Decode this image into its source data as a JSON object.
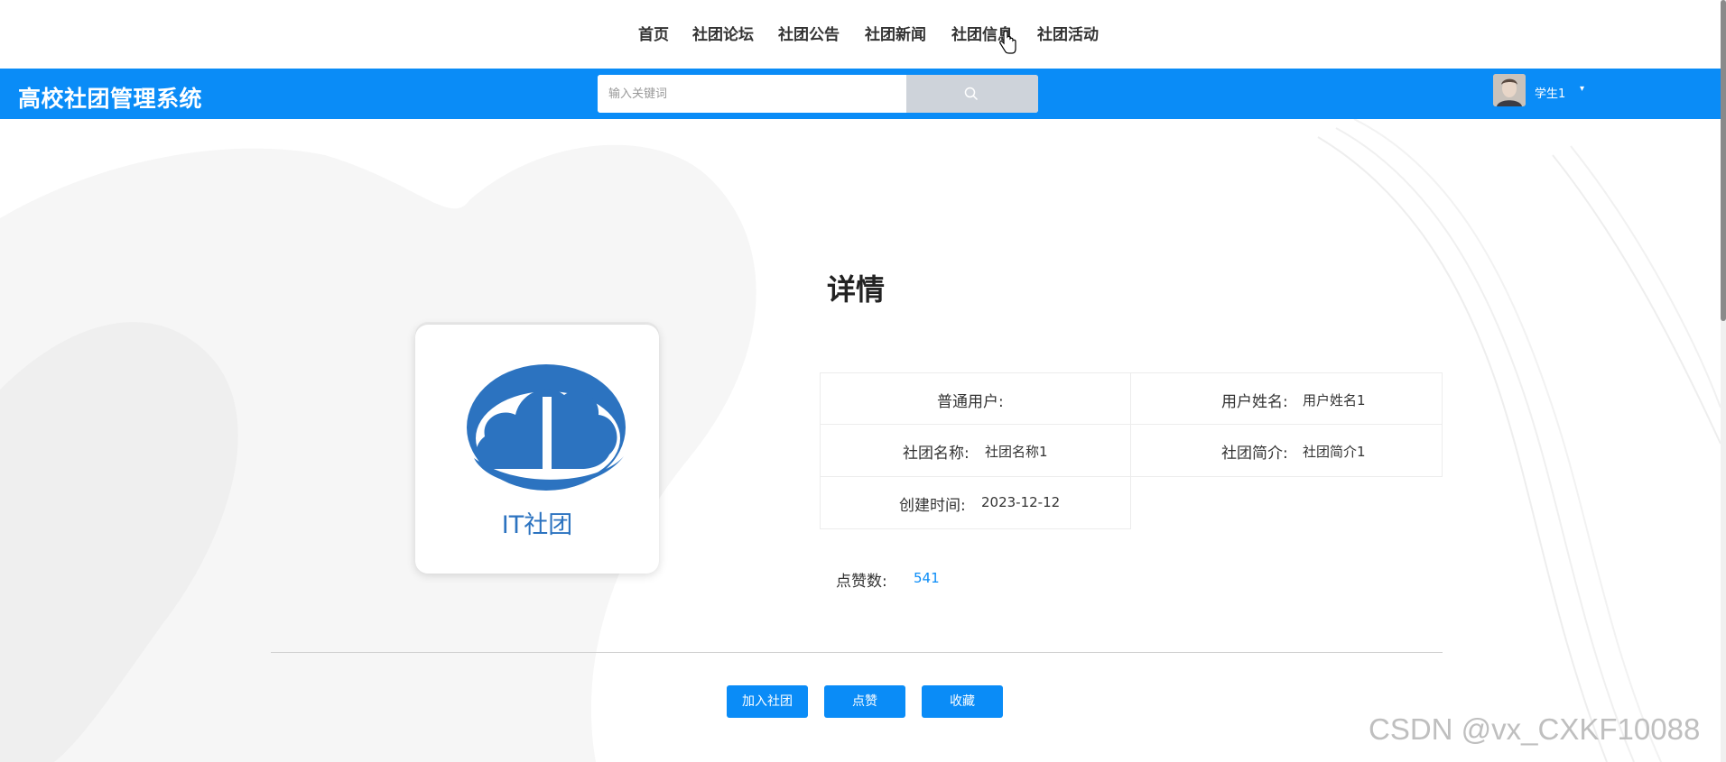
{
  "nav": {
    "items": [
      "首页",
      "社团论坛",
      "社团公告",
      "社团新闻",
      "社团信息",
      "社团活动"
    ]
  },
  "header": {
    "site_title": "高校社团管理系统",
    "search_placeholder": "输入关键词",
    "search_icon": "search-icon",
    "user_name": "学生1",
    "user_caret": "▾"
  },
  "detail": {
    "title": "详情",
    "logo_text": "IT社团",
    "fields": [
      {
        "label": "普通用户:",
        "value": ""
      },
      {
        "label": "用户姓名:",
        "value": "用户姓名1"
      },
      {
        "label": "社团名称:",
        "value": "社团名称1"
      },
      {
        "label": "社团简介:",
        "value": "社团简介1"
      },
      {
        "label": "创建时间:",
        "value": "2023-12-12"
      }
    ],
    "likes_label": "点赞数:",
    "likes_value": "541"
  },
  "actions": {
    "join": "加入社团",
    "like": "点赞",
    "favorite": "收藏"
  },
  "colors": {
    "accent": "#0a8cf7",
    "search_button": "#ced3da",
    "logo_blue": "#2c73c0"
  },
  "watermark": "CSDN @vx_CXKF10088"
}
